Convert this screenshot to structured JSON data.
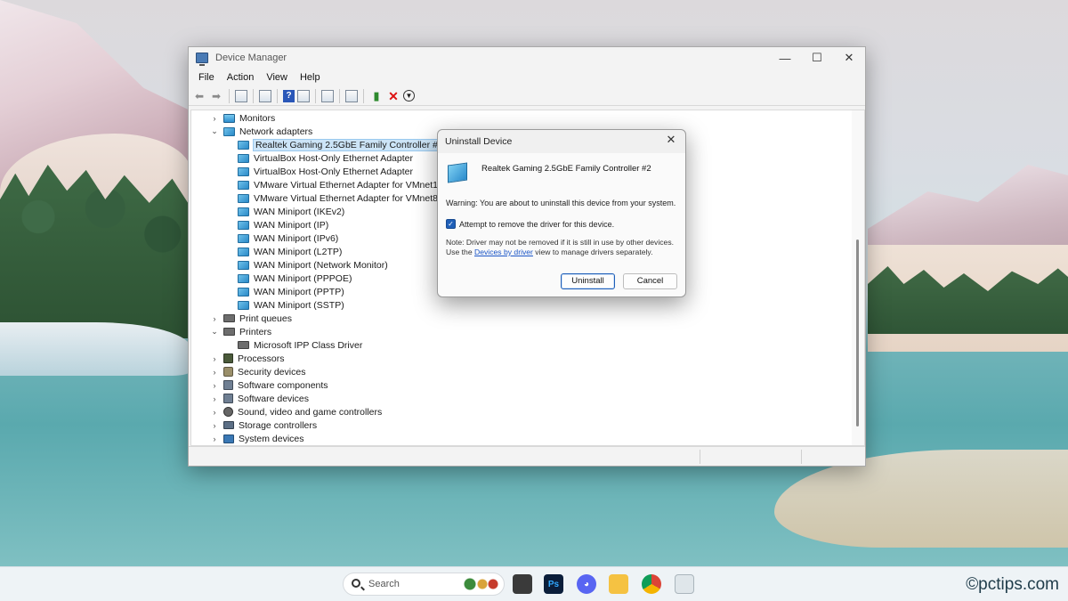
{
  "window": {
    "title": "Device Manager",
    "controls": {
      "minimize": "—",
      "maximize": "☐",
      "close": "✕"
    }
  },
  "menu": [
    "File",
    "Action",
    "View",
    "Help"
  ],
  "tree": {
    "monitors": "Monitors",
    "network_adapters": "Network adapters",
    "adapters": [
      "Realtek Gaming 2.5GbE Family Controller #2",
      "VirtualBox Host-Only Ethernet Adapter",
      "VirtualBox Host-Only Ethernet Adapter",
      "VMware Virtual Ethernet Adapter for VMnet1",
      "VMware Virtual Ethernet Adapter for VMnet8",
      "WAN Miniport (IKEv2)",
      "WAN Miniport (IP)",
      "WAN Miniport (IPv6)",
      "WAN Miniport (L2TP)",
      "WAN Miniport (Network Monitor)",
      "WAN Miniport (PPPOE)",
      "WAN Miniport (PPTP)",
      "WAN Miniport (SSTP)"
    ],
    "print_queues": "Print queues",
    "printers": "Printers",
    "printer_child": "Microsoft IPP Class Driver",
    "processors": "Processors",
    "security_devices": "Security devices",
    "software_components": "Software components",
    "software_devices": "Software devices",
    "sound": "Sound, video and game controllers",
    "storage": "Storage controllers",
    "system": "System devices"
  },
  "dialog": {
    "title": "Uninstall Device",
    "close": "✕",
    "device_name": "Realtek Gaming 2.5GbE Family Controller #2",
    "warning": "Warning: You are about to uninstall this device from your system.",
    "checkbox_label": "Attempt to remove the driver for this device.",
    "checkbox_checked": true,
    "note_prefix": "Note: Driver may not be removed if it is still in use by other devices. Use the ",
    "note_link": "Devices by driver",
    "note_suffix": " view to manage drivers separately.",
    "uninstall_button": "Uninstall",
    "cancel_button": "Cancel"
  },
  "taskbar": {
    "search_placeholder": "Search"
  },
  "watermark": "©pctips.com",
  "colors": {
    "accent": "#1f5fb8",
    "selection": "#cce4f7",
    "link": "#1a55c7",
    "remove_icon": "#dd1111"
  }
}
